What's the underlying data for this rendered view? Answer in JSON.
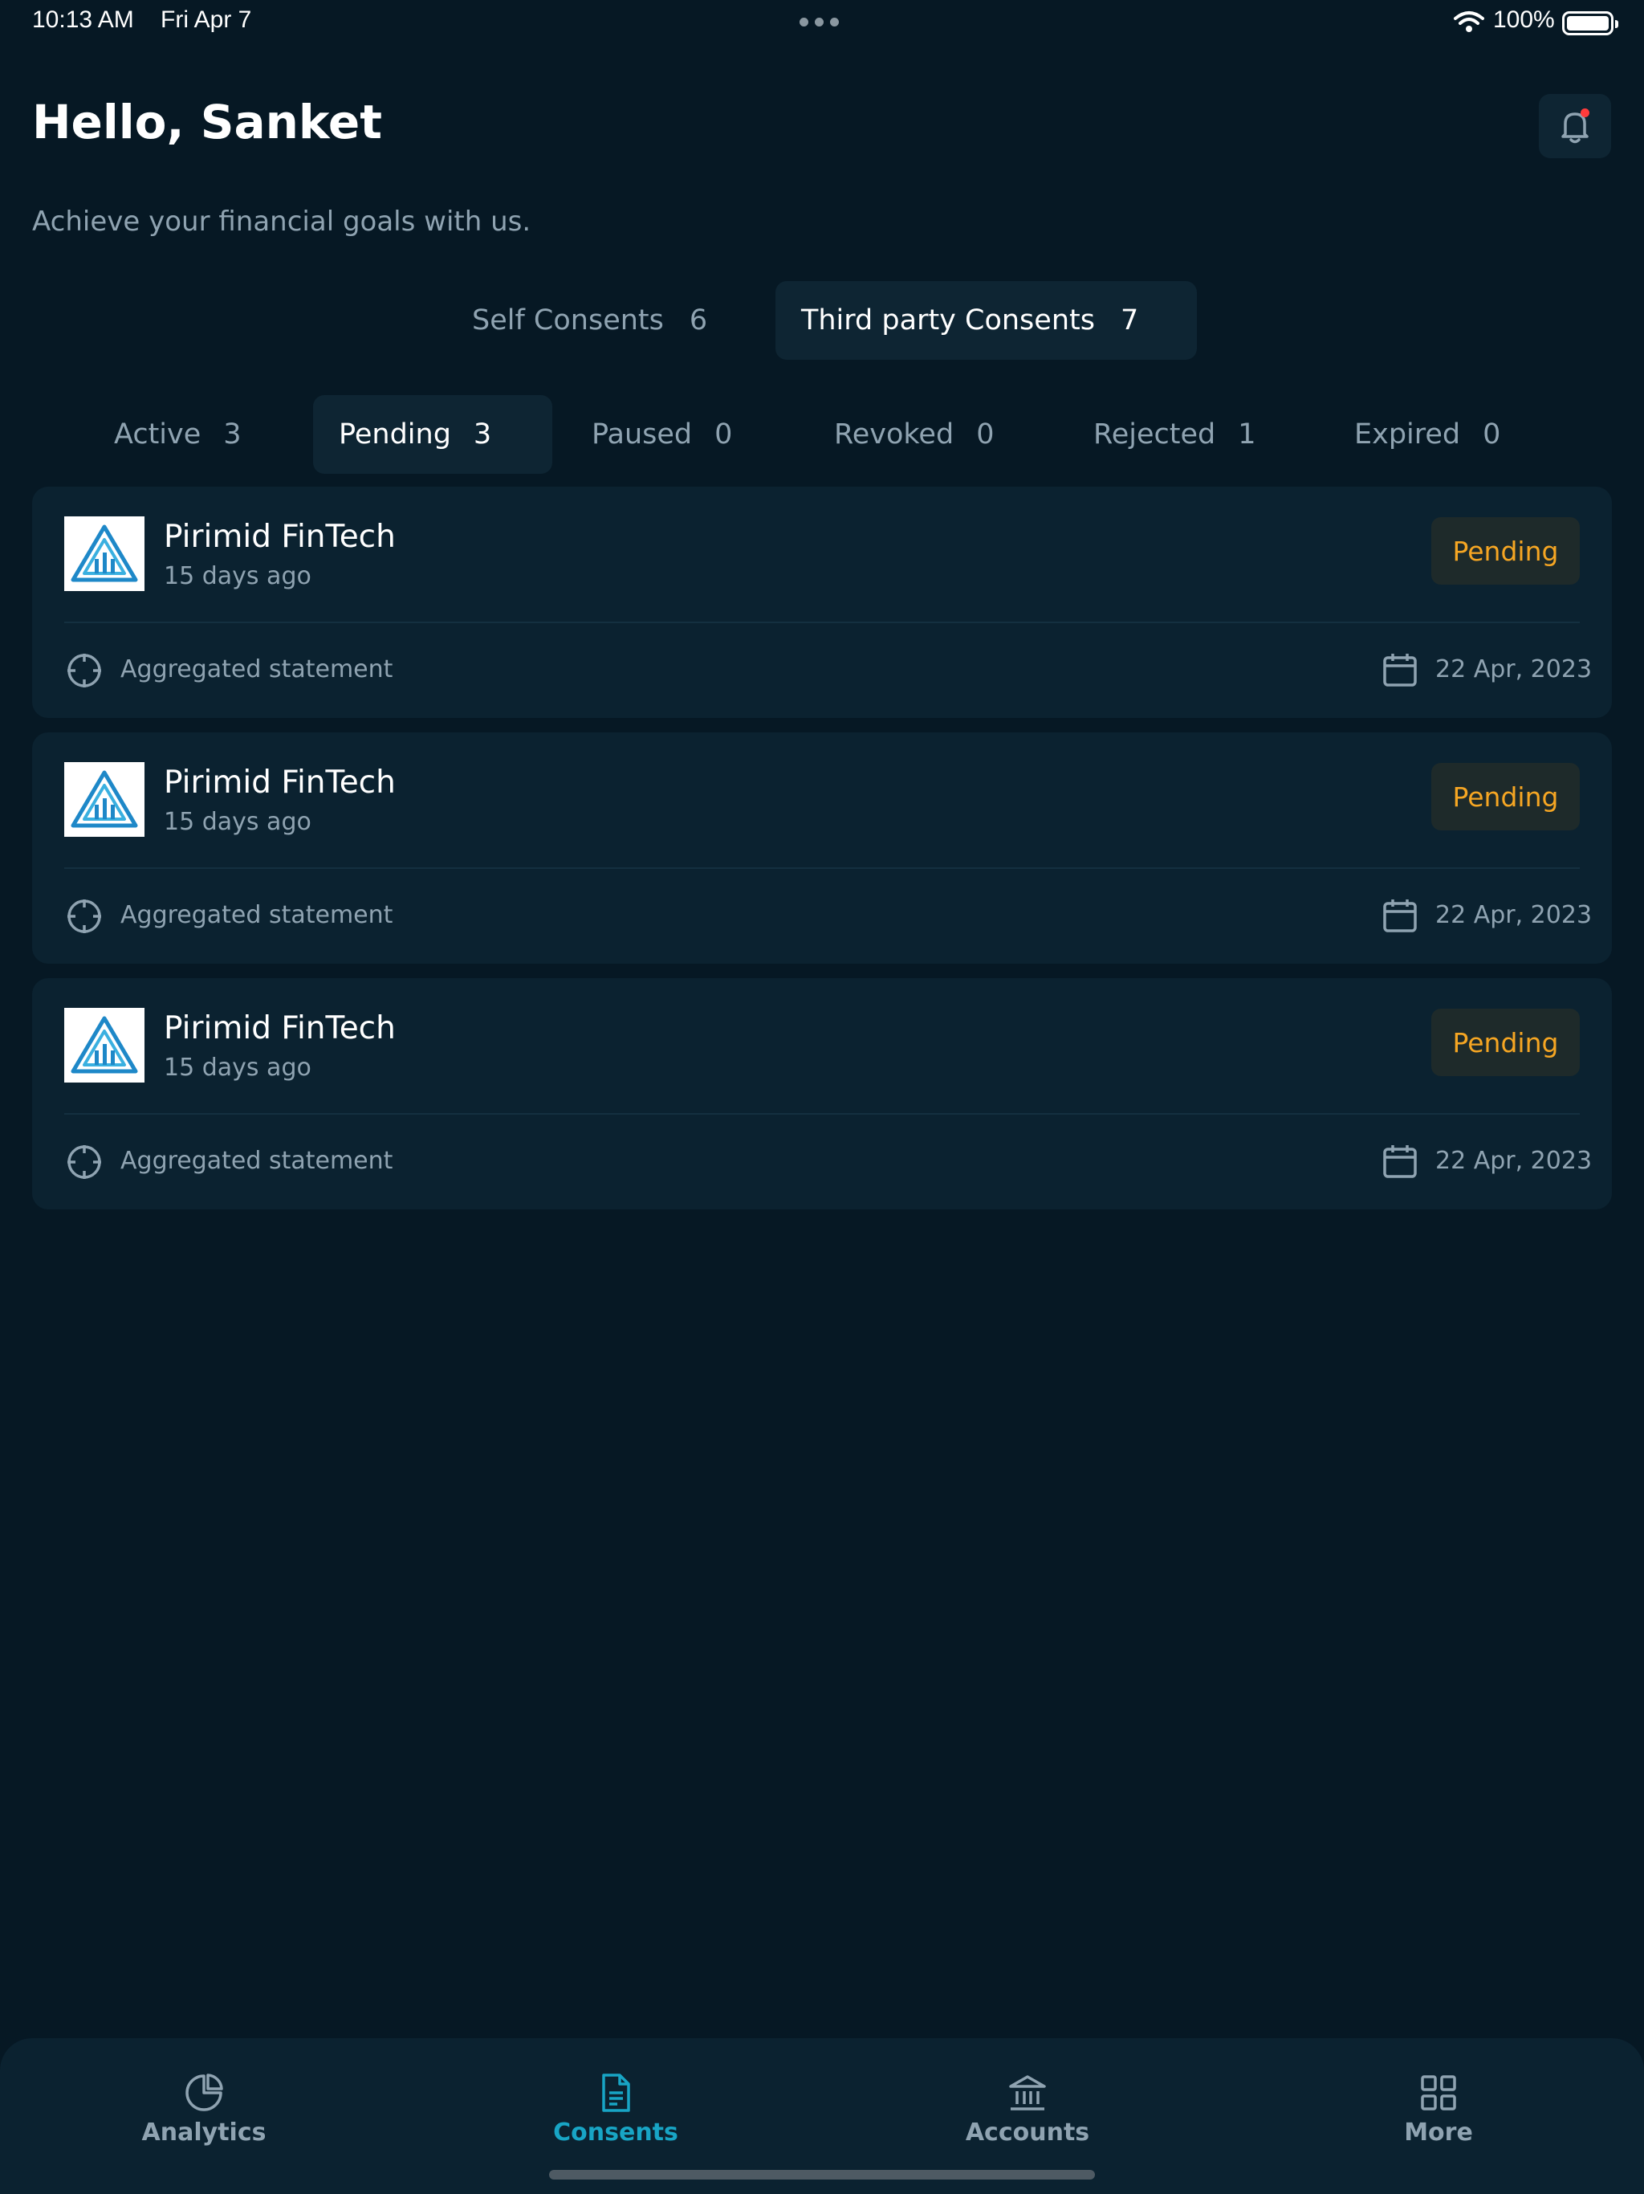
{
  "status_bar": {
    "time": "10:13 AM",
    "date": "Fri Apr 7",
    "battery": "100%"
  },
  "header": {
    "greeting": "Hello, Sanket",
    "tagline": "Achieve your financial goals with us."
  },
  "consent_types": [
    {
      "label": "Self Consents",
      "count": "6",
      "selected": false
    },
    {
      "label": "Third party Consents",
      "count": "7",
      "selected": true
    }
  ],
  "status_tabs": [
    {
      "label": "Active",
      "count": "3",
      "selected": false
    },
    {
      "label": "Pending",
      "count": "3",
      "selected": true
    },
    {
      "label": "Paused",
      "count": "0",
      "selected": false
    },
    {
      "label": "Revoked",
      "count": "0",
      "selected": false
    },
    {
      "label": "Rejected",
      "count": "1",
      "selected": false
    },
    {
      "label": "Expired",
      "count": "0",
      "selected": false
    }
  ],
  "consents": [
    {
      "name": "Pirimid FinTech",
      "time": "15 days ago",
      "status": "Pending",
      "purpose": "Aggregated statement",
      "date": "22 Apr, 2023"
    },
    {
      "name": "Pirimid FinTech",
      "time": "15 days ago",
      "status": "Pending",
      "purpose": "Aggregated statement",
      "date": "22 Apr, 2023"
    },
    {
      "name": "Pirimid FinTech",
      "time": "15 days ago",
      "status": "Pending",
      "purpose": "Aggregated statement",
      "date": "22 Apr, 2023"
    }
  ],
  "bottom_nav": [
    {
      "label": "Analytics",
      "icon": "pie-chart-icon",
      "active": false
    },
    {
      "label": "Consents",
      "icon": "document-icon",
      "active": true
    },
    {
      "label": "Accounts",
      "icon": "bank-icon",
      "active": false
    },
    {
      "label": "More",
      "icon": "grid-icon",
      "active": false
    }
  ],
  "colors": {
    "background": "#061824",
    "card": "#0b2230",
    "accent": "#18a5c5",
    "pending": "#f6a623",
    "muted_text": "#8fa3b1"
  }
}
